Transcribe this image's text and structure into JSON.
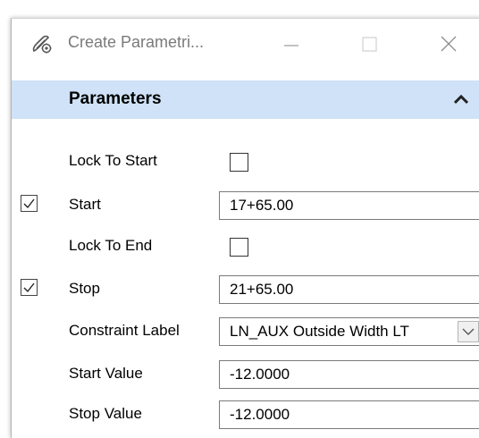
{
  "window": {
    "title": "Create Parametri...",
    "app_icon": "parametric-tool-icon",
    "controls": {
      "minimize": "minimize-icon",
      "maximize": "maximize-icon",
      "close": "close-icon"
    }
  },
  "panel": {
    "title": "Parameters",
    "collapse_icon": "chevron-up-icon"
  },
  "rows": {
    "lock_to_start": {
      "label": "Lock To Start",
      "checked": false
    },
    "start": {
      "label": "Start",
      "checked": true,
      "value": "17+65.00"
    },
    "lock_to_end": {
      "label": "Lock To End",
      "checked": false
    },
    "stop": {
      "label": "Stop",
      "checked": true,
      "value": "21+65.00"
    },
    "constraint_label": {
      "label": "Constraint Label",
      "value": "LN_AUX Outside Width LT"
    },
    "start_value": {
      "label": "Start Value",
      "value": "-12.0000"
    },
    "stop_value": {
      "label": "Stop Value",
      "value": "-12.0000"
    }
  }
}
